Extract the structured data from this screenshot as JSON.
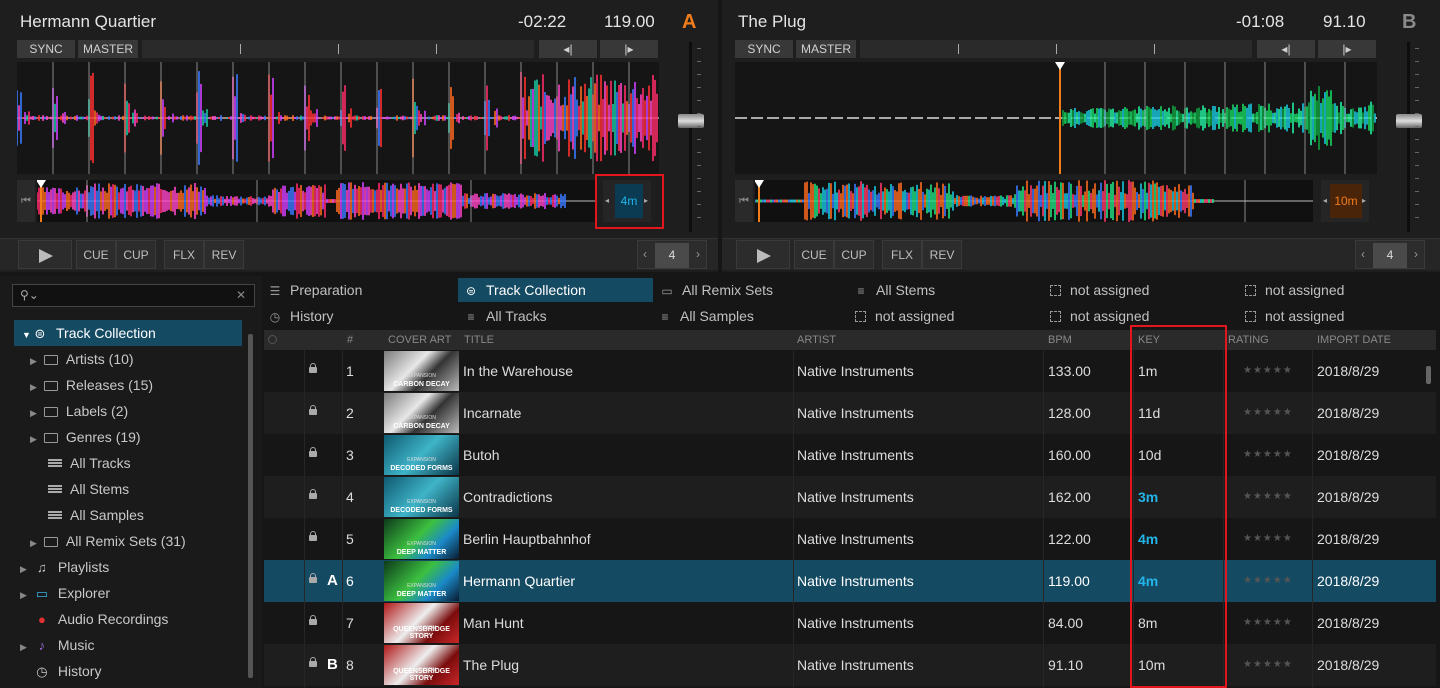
{
  "deckA": {
    "title": "Hermann Quartier",
    "remaining": "-02:22",
    "bpm": "119.00",
    "letter": "A",
    "letter_color": "#f07c1c",
    "sync": "SYNC",
    "master": "MASTER",
    "beatjump_back": "◂|",
    "beatjump_fwd": "|▸",
    "key": "4m",
    "key_color": "#23b4e8",
    "play": "play-icon",
    "cue": "CUE",
    "cup": "CUP",
    "flx": "FLX",
    "rev": "REV",
    "loop_size": "4",
    "loop_prev": "‹",
    "loop_next": "›"
  },
  "deckB": {
    "title": "The Plug",
    "remaining": "-01:08",
    "bpm": "91.10",
    "letter": "B",
    "letter_color": "#8a8a8a",
    "sync": "SYNC",
    "master": "MASTER",
    "beatjump_back": "◂|",
    "beatjump_fwd": "|▸",
    "key": "10m",
    "key_color": "#f07c1c",
    "play": "play-icon",
    "cue": "CUE",
    "cup": "CUP",
    "flx": "FLX",
    "rev": "REV",
    "loop_size": "4",
    "loop_prev": "‹",
    "loop_next": "›"
  },
  "search": {
    "placeholder": "",
    "clear": "✕"
  },
  "sidebar": {
    "items": [
      {
        "label": "Track Collection"
      },
      {
        "label": "Artists (10)"
      },
      {
        "label": "Releases (15)"
      },
      {
        "label": "Labels (2)"
      },
      {
        "label": "Genres (19)"
      },
      {
        "label": "All Tracks"
      },
      {
        "label": "All Stems"
      },
      {
        "label": "All Samples"
      },
      {
        "label": "All Remix Sets (31)"
      },
      {
        "label": "Playlists"
      },
      {
        "label": "Explorer"
      },
      {
        "label": "Audio Recordings"
      },
      {
        "label": "Music"
      },
      {
        "label": "History"
      }
    ]
  },
  "favorites": [
    "Preparation",
    "Track Collection",
    "All Remix Sets",
    "All Stems",
    "not assigned",
    "not assigned",
    "History",
    "All Tracks",
    "All Samples",
    "not assigned",
    "not assigned",
    "not assigned"
  ],
  "columns": {
    "num": "#",
    "cover": "COVER ART",
    "title": "TITLE",
    "artist": "ARTIST",
    "bpm": "BPM",
    "key": "KEY",
    "rating": "RATING",
    "date": "IMPORT DATE"
  },
  "key_highlight": "#23b4e8",
  "tracks": [
    {
      "deck": "",
      "num": "1",
      "title": "In the Warehouse",
      "artist": "Native Instruments",
      "bpm": "133.00",
      "key": "1m",
      "rating": "★★★★★",
      "date": "2018/8/29",
      "cover": "CARBON DECAY"
    },
    {
      "deck": "",
      "num": "2",
      "title": "Incarnate",
      "artist": "Native Instruments",
      "bpm": "128.00",
      "key": "11d",
      "rating": "★★★★★",
      "date": "2018/8/29",
      "cover": "CARBON DECAY"
    },
    {
      "deck": "",
      "num": "3",
      "title": "Butoh",
      "artist": "Native Instruments",
      "bpm": "160.00",
      "key": "10d",
      "rating": "★★★★★",
      "date": "2018/8/29",
      "cover": "DECODED FORMS"
    },
    {
      "deck": "",
      "num": "4",
      "title": "Contradictions",
      "artist": "Native Instruments",
      "bpm": "162.00",
      "key": "3m",
      "rating": "★★★★★",
      "date": "2018/8/29",
      "cover": "DECODED FORMS"
    },
    {
      "deck": "",
      "num": "5",
      "title": "Berlin Hauptbahnhof",
      "artist": "Native Instruments",
      "bpm": "122.00",
      "key": "4m",
      "rating": "★★★★★",
      "date": "2018/8/29",
      "cover": "DEEP MATTER"
    },
    {
      "deck": "A",
      "num": "6",
      "title": "Hermann Quartier",
      "artist": "Native Instruments",
      "bpm": "119.00",
      "key": "4m",
      "rating": "★★★★★",
      "date": "2018/8/29",
      "cover": "DEEP MATTER"
    },
    {
      "deck": "",
      "num": "7",
      "title": "Man Hunt",
      "artist": "Native Instruments",
      "bpm": "84.00",
      "key": "8m",
      "rating": "★★★★★",
      "date": "2018/8/29",
      "cover": "QUEENSBRIDGE STORY"
    },
    {
      "deck": "B",
      "num": "8",
      "title": "The Plug",
      "artist": "Native Instruments",
      "bpm": "91.10",
      "key": "10m",
      "rating": "★★★★★",
      "date": "2018/8/29",
      "cover": "QUEENSBRIDGE STORY"
    }
  ],
  "expansion": "EXPANSION"
}
